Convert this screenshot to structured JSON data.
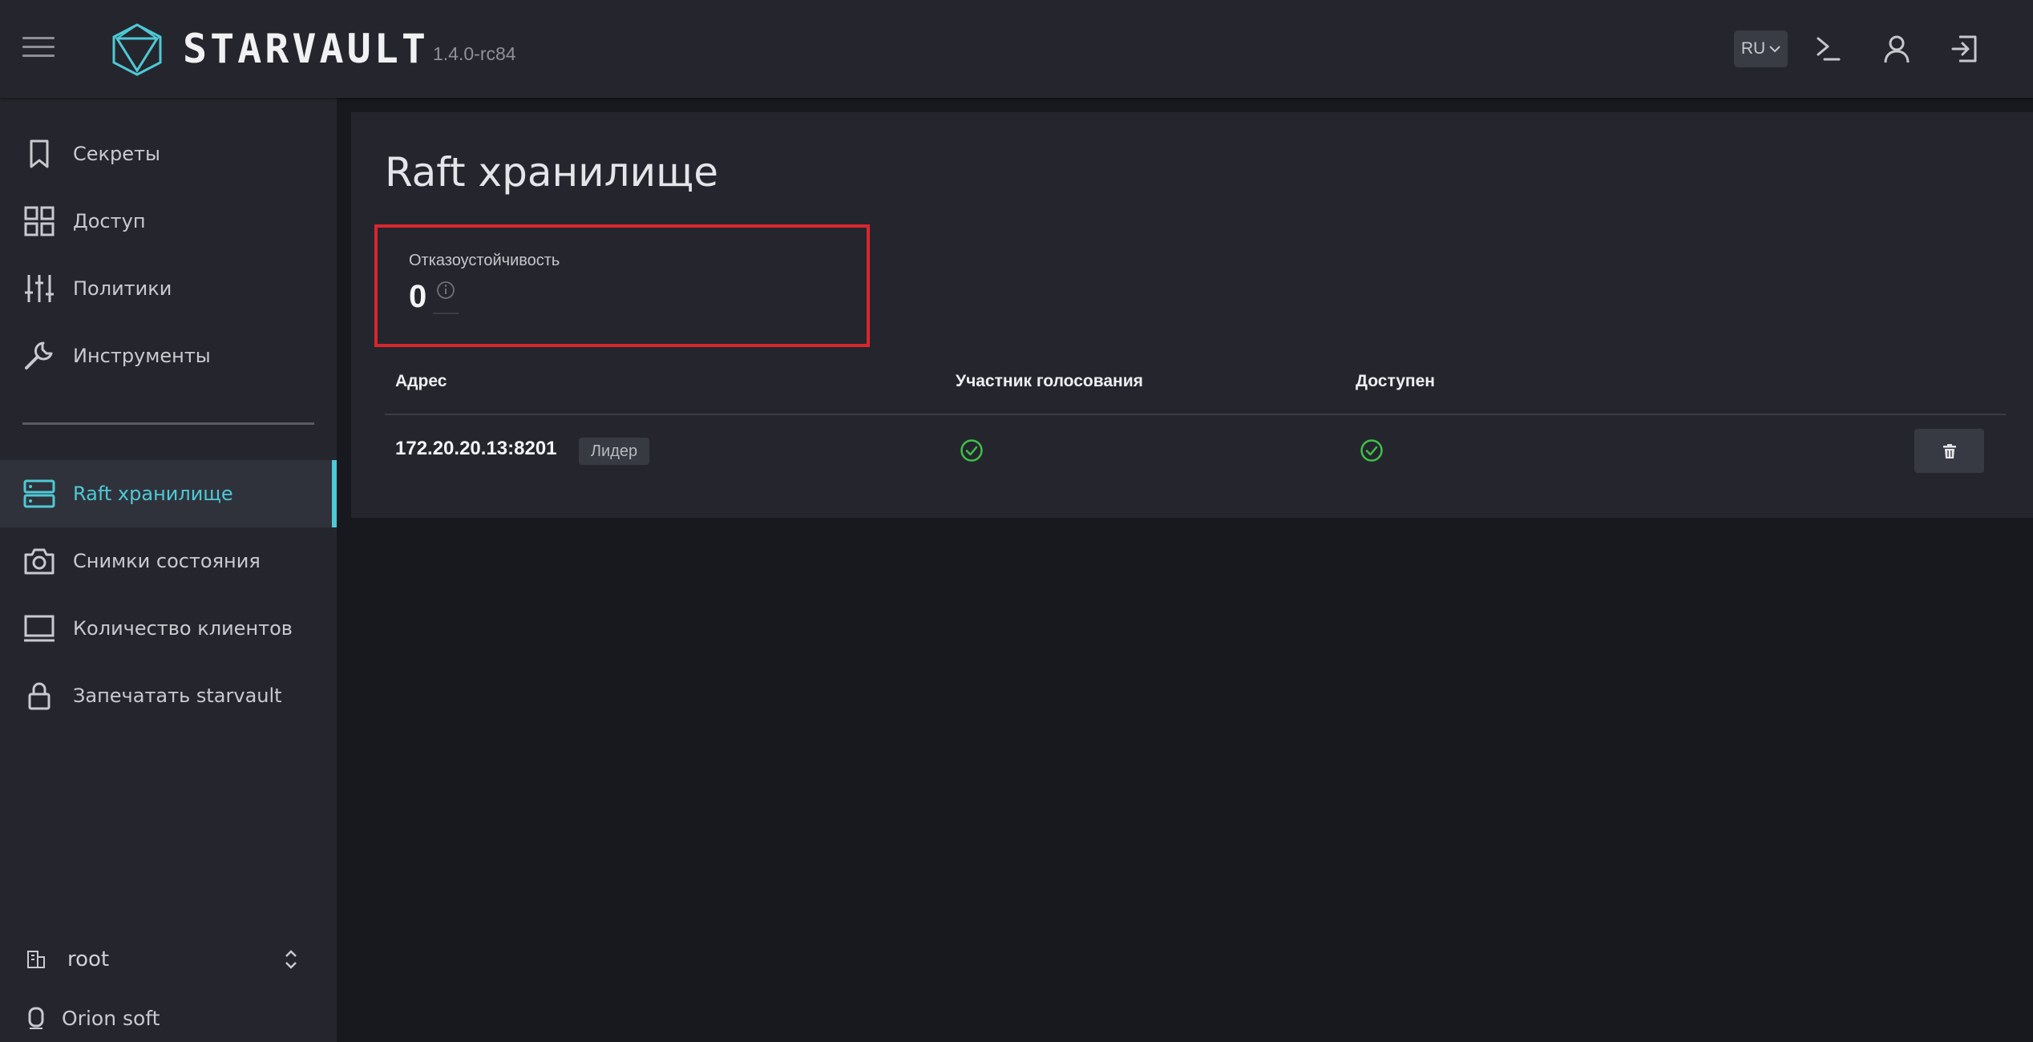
{
  "app": {
    "logo_text": "STARVAULT",
    "version": "1.4.0-rc84",
    "accent_color": "#4ec9d6"
  },
  "header": {
    "lang_label": "RU",
    "icons": [
      "menu-icon",
      "terminal-icon",
      "user-icon",
      "logout-icon"
    ]
  },
  "sidebar": {
    "items": [
      {
        "label": "Секреты",
        "icon": "bookmark-icon"
      },
      {
        "label": "Доступ",
        "icon": "grid-icon"
      },
      {
        "label": "Политики",
        "icon": "sliders-icon"
      },
      {
        "label": "Инструменты",
        "icon": "wrench-icon"
      },
      {
        "label": "Raft хранилище",
        "icon": "server-icon",
        "active": true
      },
      {
        "label": "Снимки состояния",
        "icon": "camera-icon"
      },
      {
        "label": "Количество клиентов",
        "icon": "monitor-icon"
      },
      {
        "label": "Запечатать starvault",
        "icon": "lock-icon"
      }
    ],
    "namespace": "root",
    "organization": "Orion soft"
  },
  "main": {
    "title": "Raft хранилище",
    "fault_tolerance": {
      "label": "Отказоустойчивость",
      "value": "0"
    },
    "table": {
      "columns": [
        "Адрес",
        "Участник голосования",
        "Доступен"
      ],
      "rows": [
        {
          "address": "172.20.20.13:8201",
          "badge": "Лидер",
          "voter": true,
          "available": true
        }
      ]
    }
  },
  "colors": {
    "highlight_border": "#d9262e",
    "check_green": "#3fbf4a"
  }
}
